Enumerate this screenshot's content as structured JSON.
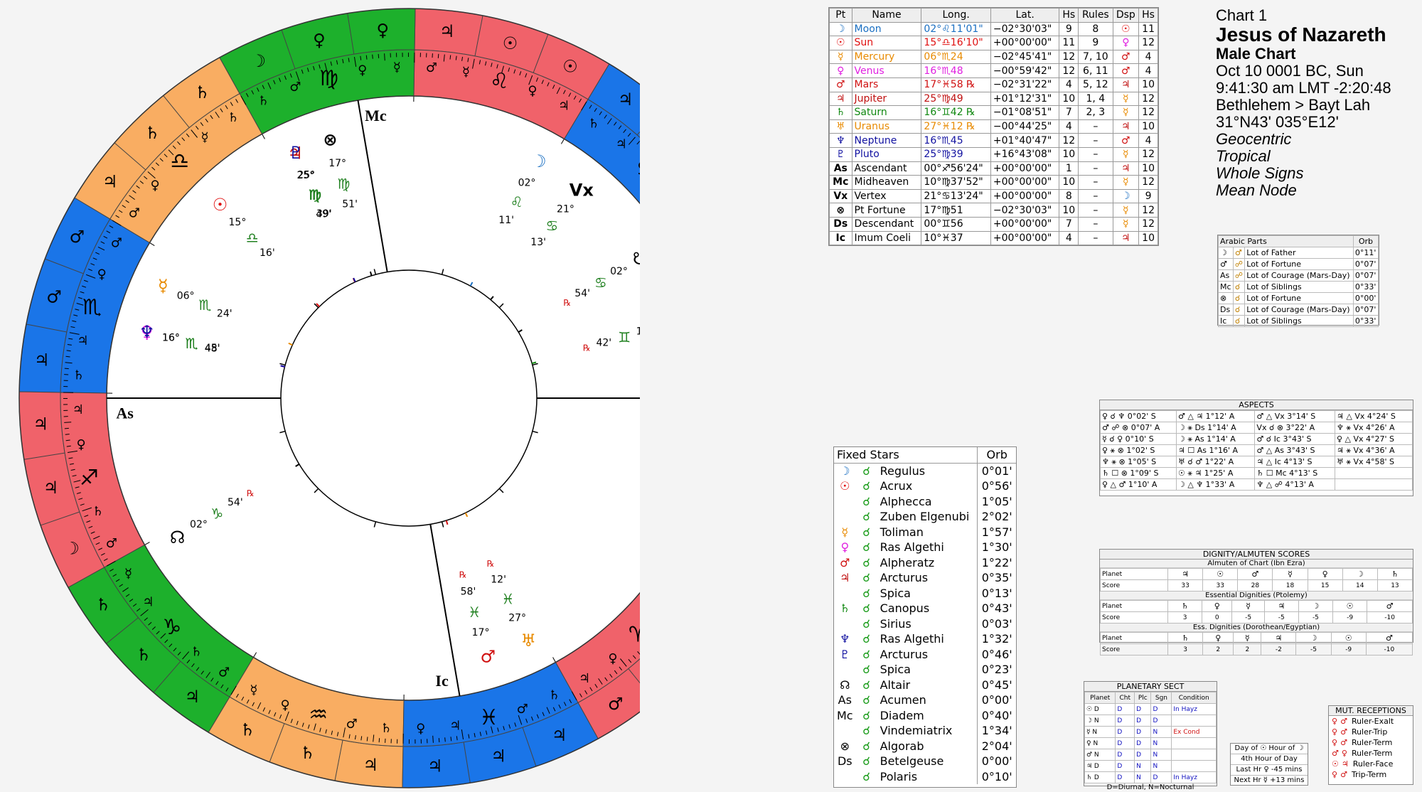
{
  "header": {
    "chart_label": "Chart 1",
    "name": "Jesus of Nazareth",
    "type": "Male Chart",
    "date": "Oct 10 0001 BC, Sun",
    "time": "9:41:30 am  LMT -2:20:48",
    "place": "Bethlehem > Bayt Lah",
    "coords": "31°N43' 035°E12'",
    "opt1": "Geocentric",
    "opt2": "Tropical",
    "opt3": "Whole Signs",
    "opt4": "Mean Node"
  },
  "colors": {
    "fire": "#f0626a",
    "earth": "#1db02c",
    "air": "#f9ad62",
    "water": "#1a75e8"
  },
  "planets_table": {
    "headers": [
      "Pt",
      "Name",
      "Long.",
      "Lat.",
      "Hs",
      "Rules",
      "Dsp",
      "Hs"
    ],
    "rows": [
      {
        "g": "☽",
        "gc": "#1a6fc2",
        "name": "Moon",
        "long": "02°♌11'01\"",
        "lat": "−02°30'03\"",
        "hs": "9",
        "rules": "8",
        "dsp": "☉",
        "dc": "#e01010",
        "hs2": "11"
      },
      {
        "g": "☉",
        "gc": "#e01010",
        "name": "Sun",
        "long": "15°♎16'10\"",
        "lat": "+00°00'00\"",
        "hs": "11",
        "rules": "9",
        "dsp": "♀",
        "dc": "#e020e0",
        "hs2": "12"
      },
      {
        "g": "☿",
        "gc": "#e88a00",
        "name": "Mercury",
        "long": "06°♏24",
        "lat": "−02°45'41\"",
        "hs": "12",
        "rules": "7, 10",
        "dsp": "♂",
        "dc": "#d01010",
        "hs2": "4"
      },
      {
        "g": "♀",
        "gc": "#e020e0",
        "name": "Venus",
        "long": "16°♏48",
        "lat": "−00°59'42\"",
        "hs": "12",
        "rules": "6, 11",
        "dsp": "♂",
        "dc": "#d01010",
        "hs2": "4"
      },
      {
        "g": "♂",
        "gc": "#d01010",
        "name": "Mars",
        "long": "17°♓58 ℞",
        "lat": "−02°31'22\"",
        "hs": "4",
        "rules": "5, 12",
        "dsp": "♃",
        "dc": "#c01010",
        "hs2": "10"
      },
      {
        "g": "♃",
        "gc": "#c01010",
        "name": "Jupiter",
        "long": "25°♍49",
        "lat": "+01°12'31\"",
        "hs": "10",
        "rules": "1, 4",
        "dsp": "☿",
        "dc": "#e88a00",
        "hs2": "12"
      },
      {
        "g": "♄",
        "gc": "#108810",
        "name": "Saturn",
        "long": "16°♊42 ℞",
        "lat": "−01°08'51\"",
        "hs": "7",
        "rules": "2, 3",
        "dsp": "☿",
        "dc": "#e88a00",
        "hs2": "12"
      },
      {
        "g": "♅",
        "gc": "#e88a00",
        "name": "Uranus",
        "long": "27°♓12 ℞",
        "lat": "−00°44'25\"",
        "hs": "4",
        "rules": "–",
        "dsp": "♃",
        "dc": "#c01010",
        "hs2": "10"
      },
      {
        "g": "♆",
        "gc": "#1010a0",
        "name": "Neptune",
        "long": "16°♏45",
        "lat": "+01°40'47\"",
        "hs": "12",
        "rules": "–",
        "dsp": "♂",
        "dc": "#d01010",
        "hs2": "4"
      },
      {
        "g": "♇",
        "gc": "#1010a0",
        "name": "Pluto",
        "long": "25°♍39",
        "lat": "+16°43'08\"",
        "hs": "10",
        "rules": "–",
        "dsp": "☿",
        "dc": "#e88a00",
        "hs2": "12"
      },
      {
        "g": "As",
        "gc": "#000",
        "name": "Ascendant",
        "long": "00°♐56'24\"",
        "lat": "+00°00'00\"",
        "hs": "1",
        "rules": "–",
        "dsp": "♃",
        "dc": "#c01010",
        "hs2": "10"
      },
      {
        "g": "Mc",
        "gc": "#000",
        "name": "Midheaven",
        "long": "10°♍37'52\"",
        "lat": "+00°00'00\"",
        "hs": "10",
        "rules": "–",
        "dsp": "☿",
        "dc": "#e88a00",
        "hs2": "12"
      },
      {
        "g": "Vx",
        "gc": "#000",
        "name": "Vertex",
        "long": "21°♋13'24\"",
        "lat": "+00°00'00\"",
        "hs": "8",
        "rules": "–",
        "dsp": "☽",
        "dc": "#1a6fc2",
        "hs2": "9"
      },
      {
        "g": "⊗",
        "gc": "#000",
        "name": "Pt Fortune",
        "long": "17°♍51",
        "lat": "−02°30'03\"",
        "hs": "10",
        "rules": "–",
        "dsp": "☿",
        "dc": "#e88a00",
        "hs2": "12"
      },
      {
        "g": "Ds",
        "gc": "#000",
        "name": "Descendant",
        "long": "00°♊56",
        "lat": "+00°00'00\"",
        "hs": "7",
        "rules": "–",
        "dsp": "☿",
        "dc": "#e88a00",
        "hs2": "12"
      },
      {
        "g": "Ic",
        "gc": "#000",
        "name": "Imum Coeli",
        "long": "10°♓37",
        "lat": "+00°00'00\"",
        "hs": "4",
        "rules": "–",
        "dsp": "♃",
        "dc": "#c01010",
        "hs2": "10"
      }
    ]
  },
  "arabic_parts": {
    "title": "Arabic Parts",
    "orb_label": "Orb",
    "rows": [
      {
        "a": "☽",
        "b": "♂",
        "name": "Lot of Father",
        "orb": "0°11'"
      },
      {
        "a": "♂",
        "b": "☍",
        "name": "Lot of Fortune",
        "orb": "0°07'"
      },
      {
        "a": "As",
        "b": "☍",
        "name": "Lot of Courage (Mars-Day)",
        "orb": "0°07'"
      },
      {
        "a": "Mc",
        "b": "☌",
        "name": "Lot of Siblings",
        "orb": "0°33'"
      },
      {
        "a": "⊗",
        "b": "☌",
        "name": "Lot of Fortune",
        "orb": "0°00'"
      },
      {
        "a": "Ds",
        "b": "☌",
        "name": "Lot of Courage (Mars-Day)",
        "orb": "0°07'"
      },
      {
        "a": "Ic",
        "b": "☌",
        "name": "Lot of Siblings",
        "orb": "0°33'"
      }
    ]
  },
  "aspects": {
    "title": "ASPECTS",
    "rows": [
      [
        "♀ ☌ ♆ 0°02' S",
        "♂ △ ♃ 1°12' A",
        "♂ △ Vx 3°14' S",
        "♃ △ Vx 4°24' S"
      ],
      [
        "♂ ☍ ⊗ 0°07' A",
        "☽ ⚹ Ds 1°14' A",
        "Vx ☌ ⊗ 3°22' A",
        "♆ ⚹ Vx 4°26' A"
      ],
      [
        "☿ ☌ ♀ 0°10' S",
        "☽ ⚹ As 1°14' A",
        "♂ ☌ Ic 3°43' S",
        "♀ △ Vx 4°27' S"
      ],
      [
        "♀ ⚹ ⊗ 1°02' S",
        "♃ ☐ As 1°16' A",
        "♂ △ As 3°43' S",
        "♃ ⚹ Vx 4°36' A"
      ],
      [
        "♆ ⚹ ⊗ 1°05' S",
        "♅ ☌ ♂ 1°22' A",
        "♃ △ Ic 4°13' S",
        "♅ ⚹ Vx 4°58' S"
      ],
      [
        "♄ ☐ ⊗ 1°09' S",
        "☉ ⚹ ♃ 1°25' A",
        "♄ ☐ Mc 4°13' S",
        ""
      ],
      [
        "♀ △ ♂ 1°10' A",
        "☽ △ ♆ 1°33' A",
        "♆ △ ☍ 4°13' A",
        ""
      ]
    ]
  },
  "fixed_stars": {
    "title": "Fixed Stars",
    "orb_label": "Orb",
    "rows": [
      {
        "p": "☽",
        "pc": "#1a6fc2",
        "name": "Regulus",
        "orb": "0°01'"
      },
      {
        "p": "☉",
        "pc": "#e01010",
        "name": "Acrux",
        "orb": "0°56'"
      },
      {
        "p": "",
        "pc": "#000",
        "name": "Alphecca",
        "orb": "1°05'"
      },
      {
        "p": "",
        "pc": "#000",
        "name": "Zuben Elgenubi",
        "orb": "2°02'"
      },
      {
        "p": "☿",
        "pc": "#e88a00",
        "name": "Toliman",
        "orb": "1°57'"
      },
      {
        "p": "♀",
        "pc": "#e020e0",
        "name": "Ras Algethi",
        "orb": "1°30'"
      },
      {
        "p": "♂",
        "pc": "#d01010",
        "name": "Alpheratz",
        "orb": "1°22'"
      },
      {
        "p": "♃",
        "pc": "#c01010",
        "name": "Arcturus",
        "orb": "0°35'"
      },
      {
        "p": "",
        "pc": "#000",
        "name": "Spica",
        "orb": "0°13'"
      },
      {
        "p": "♄",
        "pc": "#108810",
        "name": "Canopus",
        "orb": "0°43'"
      },
      {
        "p": "",
        "pc": "#000",
        "name": "Sirius",
        "orb": "0°03'"
      },
      {
        "p": "♆",
        "pc": "#1010a0",
        "name": "Ras Algethi",
        "orb": "1°32'"
      },
      {
        "p": "♇",
        "pc": "#1010a0",
        "name": "Arcturus",
        "orb": "0°46'"
      },
      {
        "p": "",
        "pc": "#000",
        "name": "Spica",
        "orb": "0°23'"
      },
      {
        "p": "☊",
        "pc": "#000",
        "name": "Altair",
        "orb": "0°45'"
      },
      {
        "p": "As",
        "pc": "#000",
        "name": "Acumen",
        "orb": "0°00'"
      },
      {
        "p": "Mc",
        "pc": "#000",
        "name": "Diadem",
        "orb": "0°40'"
      },
      {
        "p": "",
        "pc": "#000",
        "name": "Vindemiatrix",
        "orb": "1°34'"
      },
      {
        "p": "⊗",
        "pc": "#000",
        "name": "Algorab",
        "orb": "2°04'"
      },
      {
        "p": "Ds",
        "pc": "#000",
        "name": "Betelgeuse",
        "orb": "0°00'"
      },
      {
        "p": "",
        "pc": "#000",
        "name": "Polaris",
        "orb": "0°10'"
      }
    ]
  },
  "dignity": {
    "title": "DIGNITY/ALMUTEN SCORES",
    "sections": [
      {
        "sub": "Almuten of Chart (Ibn Ezra)",
        "planets": [
          "♃",
          "☉",
          "♂",
          "☿",
          "♀",
          "☽",
          "♄"
        ],
        "scores": [
          "33",
          "33",
          "28",
          "18",
          "15",
          "14",
          "13"
        ]
      },
      {
        "sub": "Essential Dignities (Ptolemy)",
        "planets": [
          "♄",
          "♀",
          "☿",
          "♃",
          "☽",
          "☉",
          "♂"
        ],
        "scores": [
          "3",
          "0",
          "-5",
          "-5",
          "-5",
          "-9",
          "-10"
        ]
      },
      {
        "sub": "Ess. Dignities (Dorothean/Egyptian)",
        "planets": [
          "♄",
          "♀",
          "☿",
          "♃",
          "☽",
          "☉",
          "♂"
        ],
        "scores": [
          "3",
          "2",
          "2",
          "-2",
          "-5",
          "-9",
          "-10"
        ]
      }
    ],
    "planet_label": "Planet",
    "score_label": "Score"
  },
  "sect": {
    "title": "PLANETARY SECT",
    "headers": [
      "Planet",
      "Cht",
      "Plc",
      "Sgn",
      "Condition"
    ],
    "rows": [
      [
        "☉ D",
        "D",
        "D",
        "D",
        "In Hayz"
      ],
      [
        "☽ N",
        "D",
        "D",
        "D",
        ""
      ],
      [
        "☿ N",
        "D",
        "D",
        "N",
        "Ex Cond"
      ],
      [
        "♀ N",
        "D",
        "D",
        "N",
        ""
      ],
      [
        "♂ N",
        "D",
        "D",
        "N",
        ""
      ],
      [
        "♃ D",
        "D",
        "N",
        "N",
        ""
      ],
      [
        "♄ D",
        "D",
        "N",
        "D",
        "In Hayz"
      ]
    ],
    "footer": "D=Diurnal, N=Nocturnal"
  },
  "day_hour": {
    "day": "Day of ☉  Hour of ☽",
    "hour": "4th Hour of Day",
    "last": "Last Hr  ♀  -45 mins",
    "next": "Next Hr  ☿  +13 mins"
  },
  "receptions": {
    "title": "MUT. RECEPTIONS",
    "rows": [
      {
        "a": "♀",
        "b": "♂",
        "txt": "Ruler-Exalt"
      },
      {
        "a": "♀",
        "b": "♂",
        "txt": "Ruler-Trip"
      },
      {
        "a": "♀",
        "b": "♂",
        "txt": "Ruler-Term"
      },
      {
        "a": "♂",
        "b": "♀",
        "txt": "Ruler-Term"
      },
      {
        "a": "☉",
        "b": "♃",
        "txt": "Ruler-Face"
      },
      {
        "a": "♀",
        "b": "♂",
        "txt": "Trip-Term"
      }
    ]
  },
  "wheel": {
    "asc_deg": 240.94,
    "signs_glyphs": [
      "♈",
      "♉",
      "♊",
      "♋",
      "♌",
      "♍",
      "♎",
      "♏",
      "♐",
      "♑",
      "♒",
      "♓"
    ],
    "sign_elements": [
      "fire",
      "earth",
      "air",
      "water",
      "fire",
      "earth",
      "air",
      "water",
      "fire",
      "earth",
      "air",
      "water"
    ],
    "outer_rulers": [
      [
        "♂",
        "♂",
        "☉"
      ],
      [
        "♀",
        "♀",
        "☽"
      ],
      [
        "♄",
        "♂",
        "♃"
      ],
      [
        "♂",
        "♂",
        "♃"
      ],
      [
        "☉",
        "☉",
        "♃"
      ],
      [
        "♀",
        "♀",
        "☽"
      ],
      [
        "♄",
        "♄",
        "♃"
      ],
      [
        "♂",
        "♂",
        "♃"
      ],
      [
        "♃",
        "♃",
        "☽"
      ],
      [
        "♄",
        "♄",
        "♃"
      ],
      [
        "♄",
        "♄",
        "♃"
      ],
      [
        "♃",
        "♃",
        "♃"
      ]
    ],
    "terms": [
      [
        "♃",
        "♀",
        "☿",
        "♂",
        "♄"
      ],
      [
        "♀",
        "☿",
        "♃",
        "♄",
        "♂"
      ],
      [
        "☿",
        "♃",
        "♀",
        "♂",
        "♄"
      ],
      [
        "♂",
        "♀",
        "☿",
        "♃",
        "♄"
      ],
      [
        "♃",
        "♀",
        "♄",
        "☿",
        "♂"
      ],
      [
        "☿",
        "♀",
        "♃",
        "♂",
        "♄"
      ],
      [
        "♄",
        "☿",
        "♃",
        "♀",
        "♂"
      ],
      [
        "♂",
        "♀",
        "☿",
        "♃",
        "♄"
      ],
      [
        "♃",
        "♀",
        "☿",
        "♄",
        "♂"
      ],
      [
        "☿",
        "♃",
        "♀",
        "♄",
        "♂"
      ],
      [
        "☿",
        "♀",
        "♃",
        "♂",
        "♄"
      ],
      [
        "♀",
        "♃",
        "☿",
        "♂",
        "♄"
      ]
    ],
    "planets": [
      {
        "g": "☽",
        "c": "#1a6fc2",
        "lon": 122.18,
        "deg": "02°",
        "min": "11'",
        "sg": "♌",
        "rx": ""
      },
      {
        "g": "☉",
        "c": "#e01010",
        "lon": 195.27,
        "deg": "15°",
        "min": "16'",
        "sg": "♎",
        "rx": ""
      },
      {
        "g": "☿",
        "c": "#e88a00",
        "lon": 216.4,
        "deg": "06°",
        "min": "24'",
        "sg": "♏",
        "rx": ""
      },
      {
        "g": "♀",
        "c": "#e020e0",
        "lon": 226.8,
        "deg": "16°",
        "min": "48'",
        "sg": "♏",
        "rx": ""
      },
      {
        "g": "♂",
        "c": "#d01010",
        "lon": 347.97,
        "deg": "17°",
        "min": "58'",
        "sg": "♓",
        "rx": "℞"
      },
      {
        "g": "♃",
        "c": "#c01010",
        "lon": 175.82,
        "deg": "25°",
        "min": "49'",
        "sg": "♍",
        "rx": ""
      },
      {
        "g": "♄",
        "c": "#108810",
        "lon": 76.7,
        "deg": "16°",
        "min": "42'",
        "sg": "♊",
        "rx": "℞"
      },
      {
        "g": "♅",
        "c": "#e88a00",
        "lon": 357.2,
        "deg": "27°",
        "min": "12'",
        "sg": "♓",
        "rx": "℞"
      },
      {
        "g": "♆",
        "c": "#1010a0",
        "lon": 226.75,
        "deg": "16°",
        "min": "45'",
        "sg": "♏",
        "rx": ""
      },
      {
        "g": "♇",
        "c": "#1010a0",
        "lon": 175.65,
        "deg": "25°",
        "min": "39'",
        "sg": "♍",
        "rx": ""
      },
      {
        "g": "⊗",
        "c": "#000",
        "lon": 167.85,
        "deg": "17°",
        "min": "51'",
        "sg": "♍",
        "rx": ""
      },
      {
        "g": "☊",
        "c": "#000",
        "lon": 272.0,
        "deg": "02°",
        "min": "54'",
        "sg": "♑",
        "rx": "℞"
      },
      {
        "g": "Vx",
        "c": "#000",
        "lon": 111.22,
        "deg": "21°",
        "min": "13'",
        "sg": "♋",
        "rx": ""
      },
      {
        "g": "☋",
        "c": "#000",
        "lon": 92.0,
        "deg": "02°",
        "min": "54'",
        "sg": "♋",
        "rx": "℞"
      }
    ],
    "angles": [
      {
        "label": "As",
        "lon": 240.94,
        "deg": "00°",
        "min": "56'",
        "sg": "♐"
      },
      {
        "label": "Ds",
        "lon": 60.94,
        "deg": "00°",
        "min": "56'",
        "sg": "♊"
      },
      {
        "label": "Mc",
        "lon": 160.63,
        "deg": "10°",
        "min": "37'",
        "sg": "♍"
      },
      {
        "label": "Ic",
        "lon": 340.63,
        "deg": "10°",
        "min": "37'",
        "sg": "♓"
      }
    ],
    "cusp_labels": [
      {
        "lon": 300.5,
        "deg": "01°",
        "sg": "♒"
      },
      {
        "lon": 313.5,
        "deg": "14°",
        "sg": "♒"
      },
      {
        "lon": 244.0,
        "deg": "",
        "sg": "♑"
      }
    ],
    "south_node_label": "S"
  }
}
